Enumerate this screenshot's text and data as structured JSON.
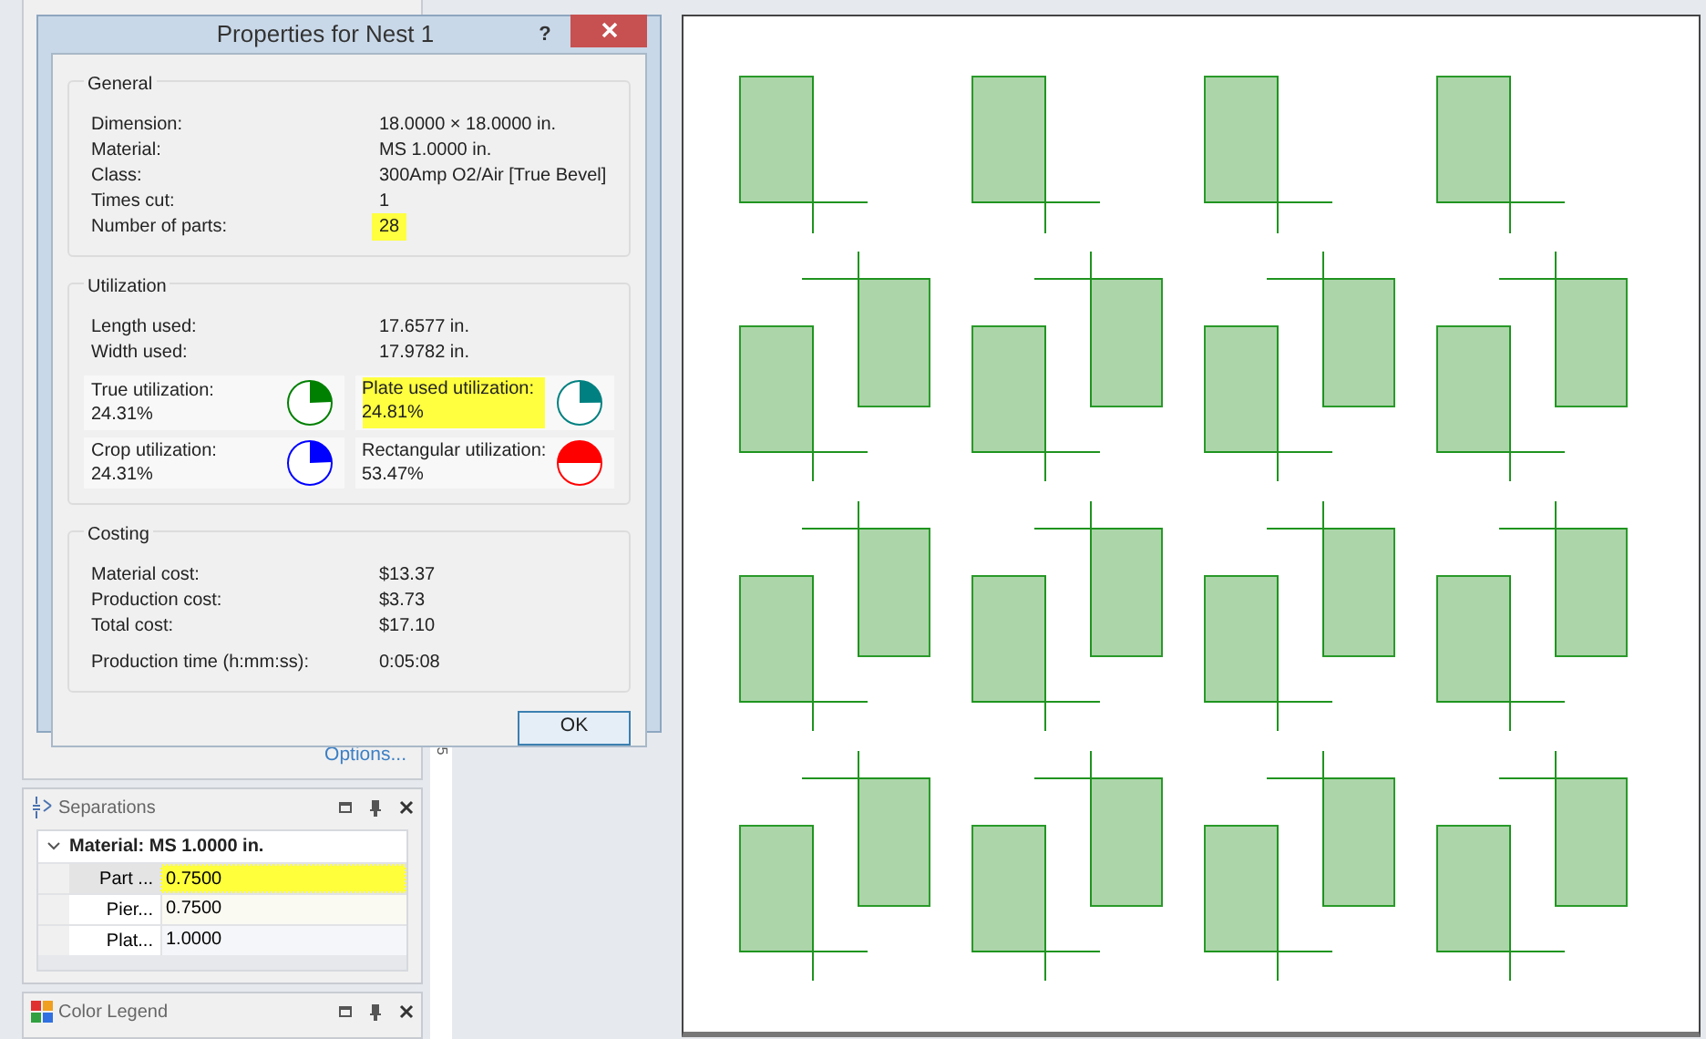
{
  "dialog": {
    "title": "Properties for Nest 1",
    "help": "?"
  },
  "general": {
    "heading": "General",
    "rows": [
      {
        "label": "Dimension:",
        "value": "18.0000 × 18.0000 in.",
        "highlighted": false
      },
      {
        "label": "Material:",
        "value": "MS 1.0000 in.",
        "highlighted": false
      },
      {
        "label": "Class:",
        "value": "300Amp O2/Air [True Bevel]",
        "highlighted": false
      },
      {
        "label": "Times cut:",
        "value": "1",
        "highlighted": false
      },
      {
        "label": "Number of parts:",
        "value": "28",
        "highlighted": true
      }
    ]
  },
  "utilization": {
    "heading": "Utilization",
    "rows": [
      {
        "label": "Length used:",
        "value": "17.6577 in."
      },
      {
        "label": "Width used:",
        "value": "17.9782 in."
      }
    ],
    "meters": [
      {
        "label": "True utilization:",
        "value": "24.31%",
        "color": "#008000",
        "kind": "sector",
        "highlighted": false
      },
      {
        "label": "Plate used utilization:",
        "value": "24.81%",
        "color": "#008080",
        "kind": "sector",
        "highlighted": true
      },
      {
        "label": "Crop utilization:",
        "value": "24.31%",
        "color": "#0000ff",
        "kind": "sector",
        "highlighted": false
      },
      {
        "label": "Rectangular utilization:",
        "value": "53.47%",
        "color": "#ff0000",
        "kind": "segment",
        "highlighted": false
      }
    ]
  },
  "costing": {
    "heading": "Costing",
    "rows": [
      {
        "label": "Material cost:",
        "value": "$13.37",
        "kind": "line"
      },
      {
        "label": "Production cost:",
        "value": "$3.73",
        "kind": "line"
      },
      {
        "label": "Total cost:",
        "value": "$17.10",
        "kind": "line"
      },
      {
        "label": "Production time (h:mm:ss):",
        "value": "0:05:08",
        "kind": "spaced"
      }
    ]
  },
  "ok_button": "OK",
  "options_link": "Options...",
  "ruler_label": "5",
  "separations": {
    "title": "Separations",
    "group": {
      "label": "Material: MS 1.0000 in.",
      "expanded": true
    },
    "rows": [
      {
        "label": "Part ...",
        "value": "0.7500",
        "highlighted": true
      },
      {
        "label": "Pier...",
        "value": "0.7500",
        "highlighted": false
      },
      {
        "label": "Plat...",
        "value": "1.0000",
        "highlighted": false
      }
    ]
  },
  "color_legend": {
    "title": "Color Legend"
  }
}
